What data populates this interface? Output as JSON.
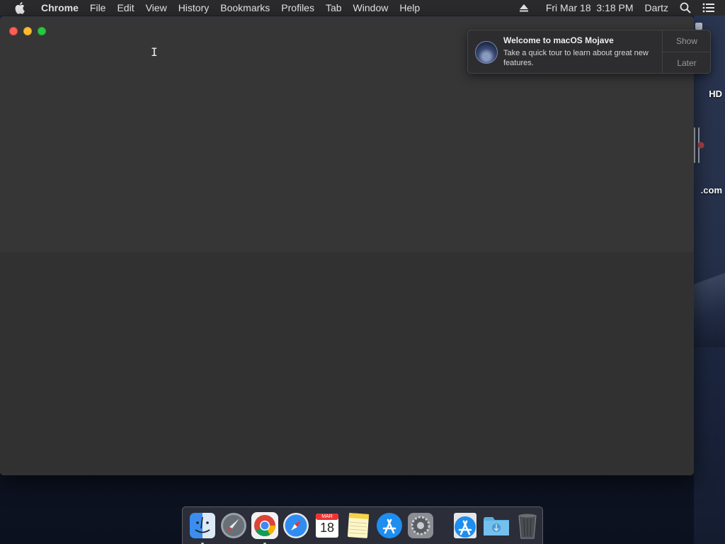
{
  "menubar": {
    "app_name": "Chrome",
    "items": [
      "File",
      "Edit",
      "View",
      "History",
      "Bookmarks",
      "Profiles",
      "Tab",
      "Window",
      "Help"
    ],
    "datetime": "Fri Mar 18  3:18 PM",
    "user": "Dartz"
  },
  "desktop": {
    "label_hd": "HD",
    "label_com": ".com"
  },
  "notification": {
    "title": "Welcome to macOS Mojave",
    "body": "Take a quick tour to learn about great new features.",
    "show_label": "Show",
    "later_label": "Later"
  },
  "dock": {
    "calendar_month": "MAR",
    "calendar_day": "18",
    "apps": [
      "finder",
      "launchpad",
      "chrome",
      "safari",
      "calendar",
      "notes",
      "app-store",
      "system-preferences",
      "app-store-installer",
      "downloads-folder",
      "trash"
    ]
  }
}
